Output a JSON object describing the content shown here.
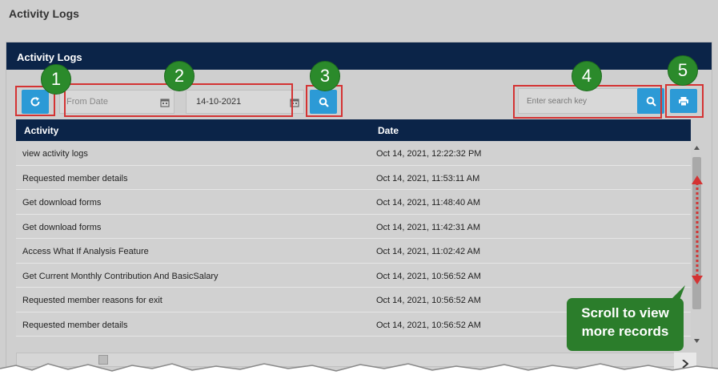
{
  "page": {
    "title": "Activity Logs"
  },
  "panel": {
    "title": "Activity Logs"
  },
  "toolbar": {
    "from_date_placeholder": "From Date",
    "to_date_value": "14-10-2021",
    "search_placeholder": "Enter search key"
  },
  "badges": [
    "1",
    "2",
    "3",
    "4",
    "5"
  ],
  "table": {
    "columns": [
      "Activity",
      "Date"
    ],
    "rows": [
      [
        "view activity logs",
        "Oct 14, 2021, 12:22:32 PM"
      ],
      [
        "Requested member details",
        "Oct 14, 2021, 11:53:11 AM"
      ],
      [
        "Get download forms",
        "Oct 14, 2021, 11:48:40 AM"
      ],
      [
        "Get download forms",
        "Oct 14, 2021, 11:42:31 AM"
      ],
      [
        "Access What If Analysis Feature",
        "Oct 14, 2021, 11:02:42 AM"
      ],
      [
        "Get Current Monthly Contribution And BasicSalary",
        "Oct 14, 2021, 10:56:52 AM"
      ],
      [
        "Requested member reasons for exit",
        "Oct 14, 2021, 10:56:52 AM"
      ],
      [
        "Requested member details",
        "Oct 14, 2021, 10:56:52 AM"
      ]
    ]
  },
  "callout": {
    "line1": "Scroll to view",
    "line2": "more records"
  },
  "icons": [
    "refresh-icon",
    "calendar-icon",
    "search-icon",
    "print-icon"
  ],
  "colors": {
    "header": "#0b2448",
    "button": "#2c9ad6",
    "highlight": "#d43333",
    "badge": "#2b8a2b"
  }
}
